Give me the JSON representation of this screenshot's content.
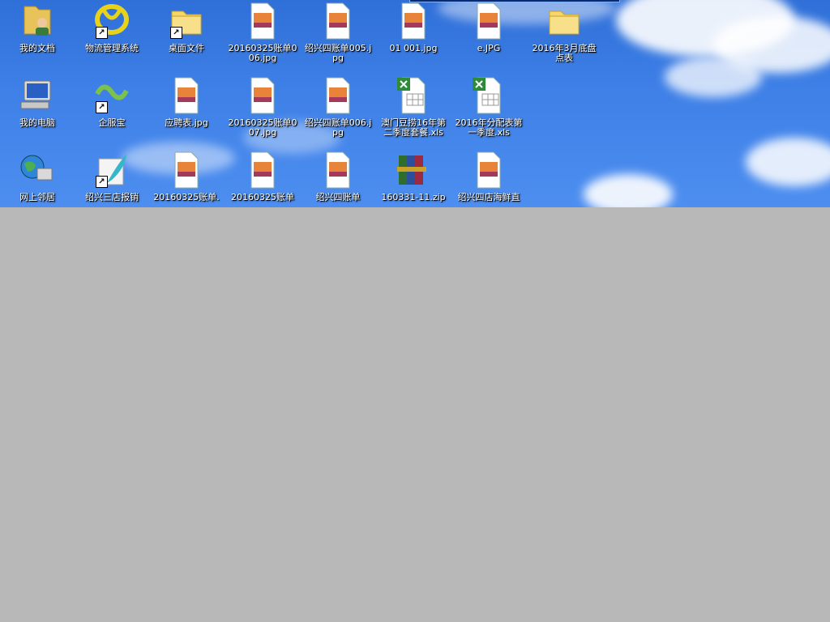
{
  "desktop": {
    "icons": [
      {
        "label": "我的文档",
        "icon": "my-documents-icon",
        "shortcut": false
      },
      {
        "label": "物流管理系统",
        "icon": "logistics-app-icon",
        "shortcut": true
      },
      {
        "label": "桌面文件",
        "icon": "folder-icon",
        "shortcut": true
      },
      {
        "label": "20160325账单006.jpg",
        "icon": "jpg-file-icon",
        "shortcut": false
      },
      {
        "label": "绍兴四账单005.jpg",
        "icon": "jpg-file-icon",
        "shortcut": false
      },
      {
        "label": "01 001.jpg",
        "icon": "jpg-file-icon",
        "shortcut": false
      },
      {
        "label": "e.JPG",
        "icon": "jpg-file-icon",
        "shortcut": false
      },
      {
        "label": "2016年3月底盘点表",
        "icon": "folder-icon",
        "shortcut": false
      },
      {
        "label": "我的电脑",
        "icon": "my-computer-icon",
        "shortcut": false
      },
      {
        "label": "企服宝",
        "icon": "qifubao-app-icon",
        "shortcut": true
      },
      {
        "label": "应聘表.jpg",
        "icon": "jpg-file-icon",
        "shortcut": false
      },
      {
        "label": "20160325账单007.jpg",
        "icon": "jpg-file-icon",
        "shortcut": false
      },
      {
        "label": "绍兴四账单006.jpg",
        "icon": "jpg-file-icon",
        "shortcut": false
      },
      {
        "label": "澳门豆捞16年第二季度套餐.xls",
        "icon": "excel-file-icon",
        "shortcut": false
      },
      {
        "label": "2016年分配表第一季度.xls",
        "icon": "excel-file-icon",
        "shortcut": false
      },
      {
        "label": "网上邻居",
        "icon": "network-places-icon",
        "shortcut": false
      },
      {
        "label": "绍兴三店报销",
        "icon": "feather-app-icon",
        "shortcut": true
      },
      {
        "label": "20160325账单.",
        "icon": "jpg-file-icon",
        "shortcut": false
      },
      {
        "label": "20160325账单",
        "icon": "jpg-file-icon",
        "shortcut": false
      },
      {
        "label": "绍兴四账单",
        "icon": "jpg-file-icon",
        "shortcut": false
      },
      {
        "label": "160331-11.zip",
        "icon": "winrar-archive-icon",
        "shortcut": false
      },
      {
        "label": "绍兴四店海鲜直",
        "icon": "jpg-file-icon",
        "shortcut": false
      }
    ]
  },
  "colors": {
    "sky": "#3d7fe6",
    "inactive_area": "#b8b8b8",
    "label_text": "#ffffff"
  }
}
